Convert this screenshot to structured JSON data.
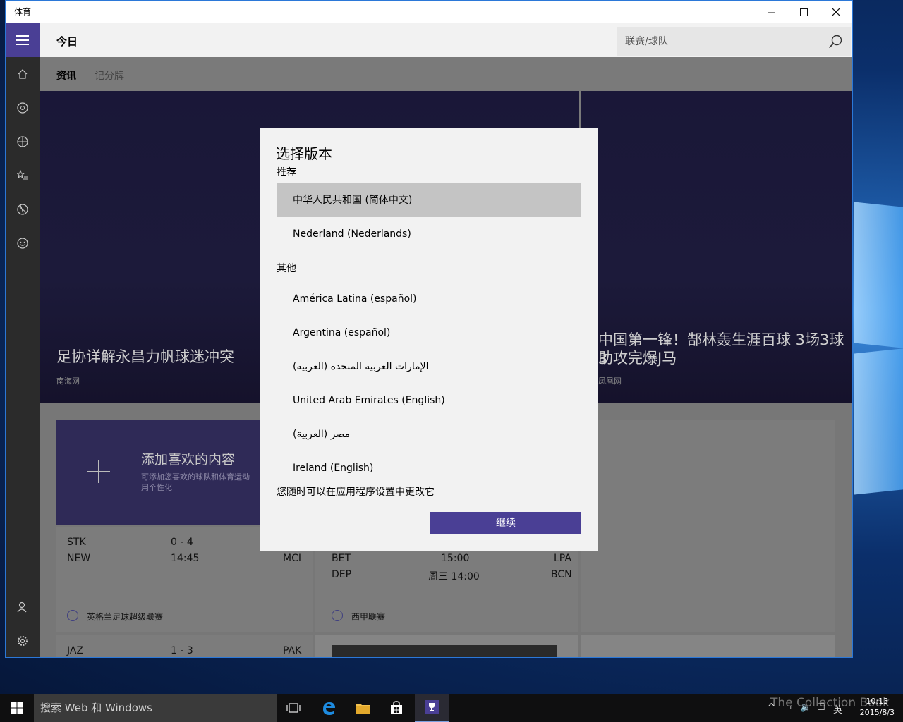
{
  "window": {
    "title": "体育"
  },
  "header": {
    "page_title": "今日",
    "search_placeholder": "联赛/球队"
  },
  "tabs": [
    {
      "label": "资讯"
    },
    {
      "label": "记分牌"
    }
  ],
  "hero": [
    {
      "title": "足协详解永昌力帆球迷冲突",
      "source": "南海网"
    },
    {
      "title_line1": "中国第一锋！郜林轰生涯百球 3场3球3",
      "title_line2": "助攻完爆J马",
      "source": "凤凰网"
    }
  ],
  "add_card": {
    "title": "添加喜欢的内容",
    "desc_line1": "可添加您喜欢的球队和体育运动",
    "desc_line2": "用个性化"
  },
  "score_cards": [
    {
      "team1": "STK",
      "score": "0 - 4",
      "team2": "NEW",
      "time": "14:45",
      "team2_right": "MCI",
      "league": "英格兰足球超级联赛"
    },
    {
      "team1": "BET",
      "time1": "15:00",
      "team1_right": "LPA",
      "team2": "DEP",
      "time2": "周三 14:00",
      "team2_right": "BCN",
      "league": "西甲联赛"
    },
    {
      "team1": "JAZ",
      "score": "1 - 3",
      "team1_right": "PAK"
    }
  ],
  "dialog": {
    "title": "选择版本",
    "recommended_label": "推荐",
    "recommended": [
      "中华人民共和国 (简体中文)",
      "Nederland (Nederlands)"
    ],
    "other_label": "其他",
    "other": [
      "América Latina (español)",
      "Argentina (español)",
      "الإمارات العربية المتحدة (العربية)",
      "United Arab Emirates (English)",
      "مصر (العربية)",
      "Ireland (English)"
    ],
    "note": "您随时可以在应用程序设置中更改它",
    "continue_label": "继续"
  },
  "taskbar": {
    "search_text": "搜索 Web 和 Windows",
    "ime": "英",
    "time": "10:13",
    "date": "2015/8/3",
    "watermark": "The Collection Book"
  },
  "colors": {
    "accent": "#4a3f95",
    "rail": "#2b2b2b"
  }
}
